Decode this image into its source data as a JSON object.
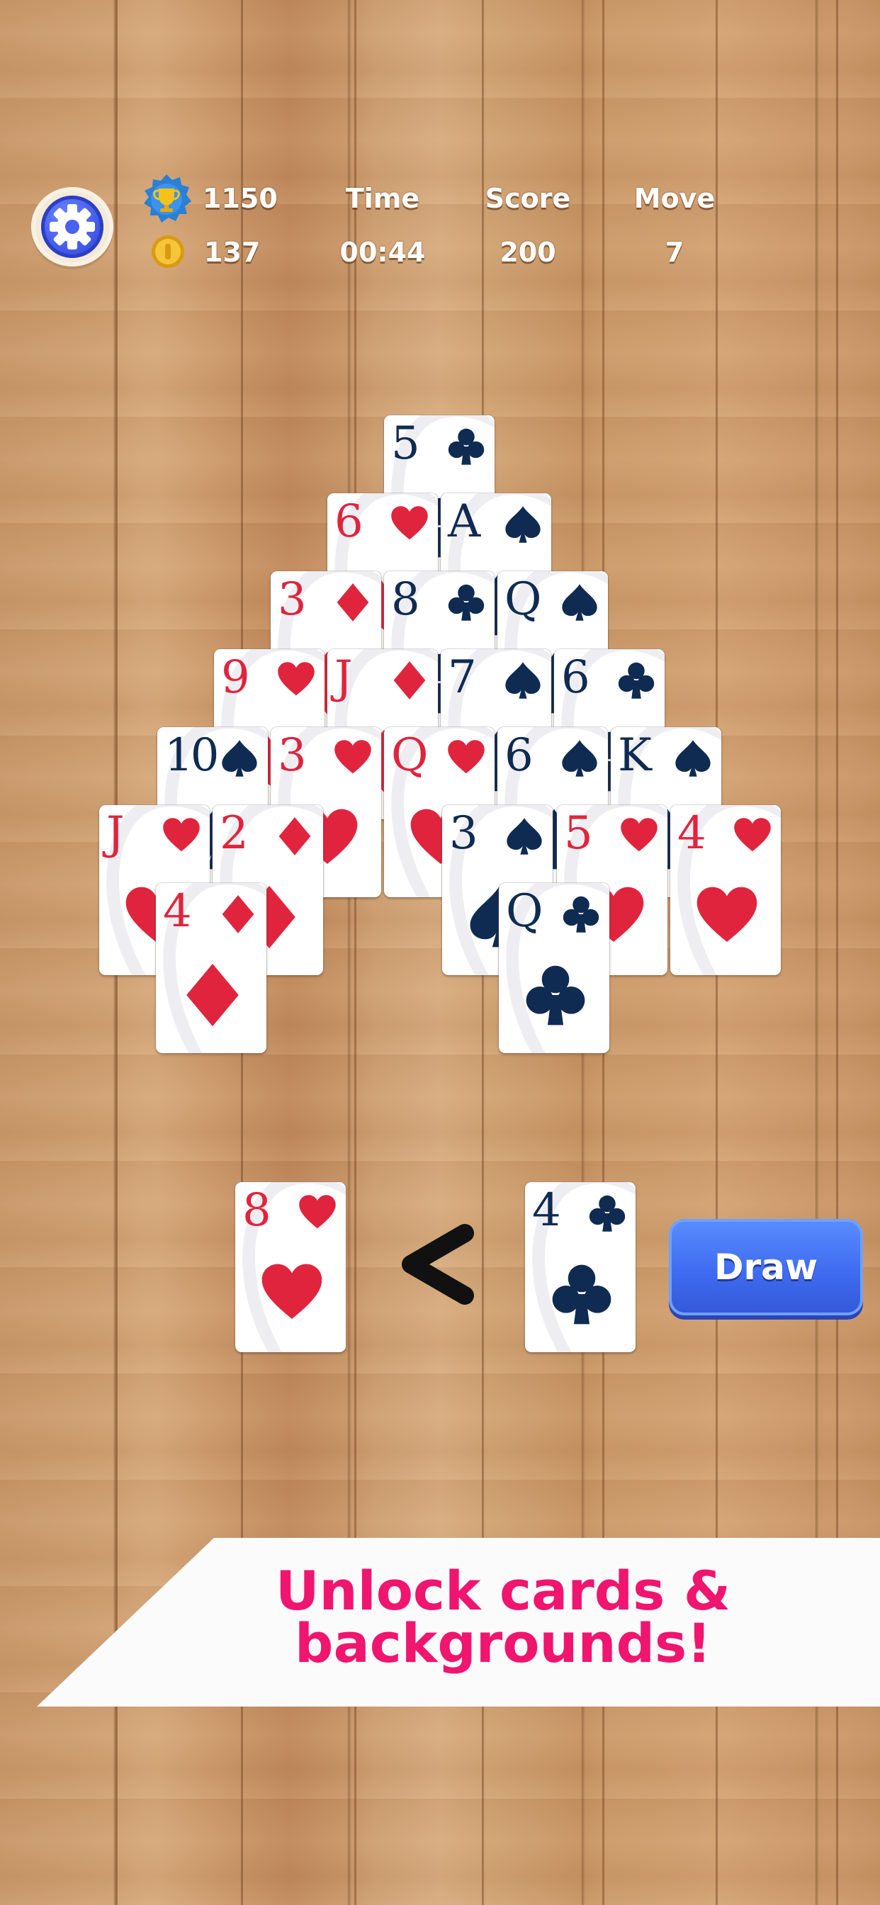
{
  "hud": {
    "trophy_value": "1150",
    "coin_value": "137",
    "time_label": "Time",
    "time_value": "00:44",
    "score_label": "Score",
    "score_value": "200",
    "move_label": "Move",
    "move_value": "7"
  },
  "icons": {
    "settings": "gear-icon",
    "trophy": "trophy-icon",
    "coin": "coin-icon",
    "compare": "less-than-icon"
  },
  "colors": {
    "red_suit": "#e0243d",
    "black_suit": "#0f2b52",
    "draw_button": "#3f6cf0",
    "banner_text": "#f0156e"
  },
  "pyramid": [
    {
      "rank": "5",
      "suit": "clubs"
    },
    {
      "rank": "6",
      "suit": "hearts"
    },
    {
      "rank": "A",
      "suit": "spades"
    },
    {
      "rank": "3",
      "suit": "diamonds"
    },
    {
      "rank": "8",
      "suit": "clubs"
    },
    {
      "rank": "Q",
      "suit": "spades"
    },
    {
      "rank": "9",
      "suit": "hearts"
    },
    {
      "rank": "J",
      "suit": "diamonds"
    },
    {
      "rank": "7",
      "suit": "spades"
    },
    {
      "rank": "6",
      "suit": "clubs"
    },
    {
      "rank": "10",
      "suit": "spades"
    },
    {
      "rank": "3",
      "suit": "hearts"
    },
    {
      "rank": "Q",
      "suit": "hearts"
    },
    {
      "rank": "6",
      "suit": "spades"
    },
    {
      "rank": "K",
      "suit": "spades"
    },
    {
      "rank": "J",
      "suit": "hearts"
    },
    {
      "rank": "2",
      "suit": "diamonds"
    },
    {
      "rank": "3",
      "suit": "spades"
    },
    {
      "rank": "5",
      "suit": "hearts"
    },
    {
      "rank": "4",
      "suit": "hearts"
    },
    {
      "rank": "4",
      "suit": "diamonds"
    },
    {
      "rank": "Q",
      "suit": "clubs"
    }
  ],
  "waste_card": {
    "rank": "8",
    "suit": "hearts"
  },
  "stock_card": {
    "rank": "4",
    "suit": "clubs"
  },
  "draw_button_label": "Draw",
  "banner": {
    "line1": "Unlock cards &",
    "line2": "backgrounds!"
  }
}
